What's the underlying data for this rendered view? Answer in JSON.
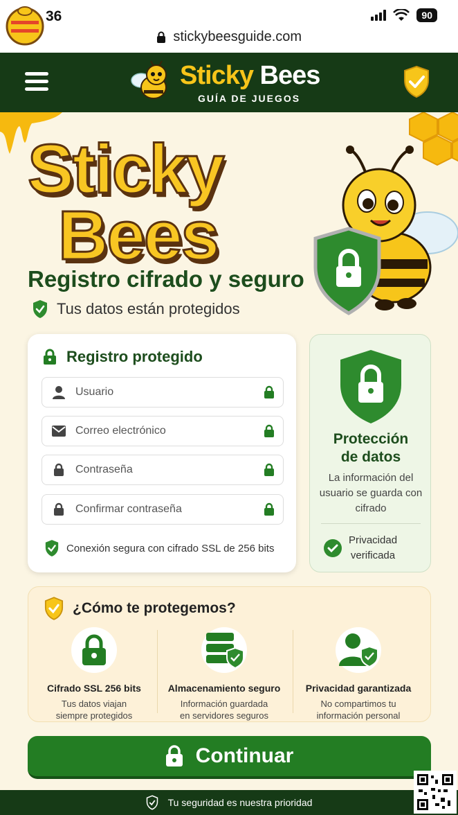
{
  "status": {
    "time": "36",
    "battery": "90"
  },
  "browser": {
    "url": "stickybeesguide.com"
  },
  "header": {
    "brand_part1": "Sticky",
    "brand_part2": "Bees",
    "tagline": "GUÍA DE JUEGOS"
  },
  "hero": {
    "title_line1": "Sticky",
    "title_line2": "Bees",
    "headline": "Registro cifrado y seguro",
    "subline": "Tus datos están protegidos"
  },
  "form": {
    "title": "Registro protegido",
    "fields": [
      {
        "placeholder": "Usuario",
        "icon": "user-icon"
      },
      {
        "placeholder": "Correo electrónico",
        "icon": "mail-icon"
      },
      {
        "placeholder": "Contraseña",
        "icon": "lock-icon"
      },
      {
        "placeholder": "Confirmar contraseña",
        "icon": "lock-icon"
      }
    ],
    "ssl_note": "Conexión segura con cifrado SSL de 256 bits"
  },
  "side": {
    "title_line1": "Protección",
    "title_line2": "de datos",
    "text": "La información del usuario se guarda con cifrado",
    "privacy_line1": "Privacidad",
    "privacy_line2": "verificada"
  },
  "how": {
    "title": "¿Cómo te protegemos?",
    "features": [
      {
        "title": "Cifrado SSL 256 bits",
        "desc_line1": "Tus datos viajan",
        "desc_line2": "siempre protegidos",
        "icon": "lock-icon"
      },
      {
        "title": "Almacenamiento seguro",
        "desc_line1": "Información guardada",
        "desc_line2": "en servidores seguros",
        "icon": "server-shield-icon"
      },
      {
        "title": "Privacidad garantizada",
        "desc_line1": "No compartimos tu",
        "desc_line2": "información personal",
        "icon": "user-shield-icon"
      }
    ]
  },
  "cta": {
    "label": "Continuar"
  },
  "footer": {
    "text": "Tu seguridad es nuestra prioridad"
  },
  "colors": {
    "brand_green": "#163a16",
    "accent_green": "#237d23",
    "honey": "#f7c51a",
    "background": "#fbf5e3"
  }
}
